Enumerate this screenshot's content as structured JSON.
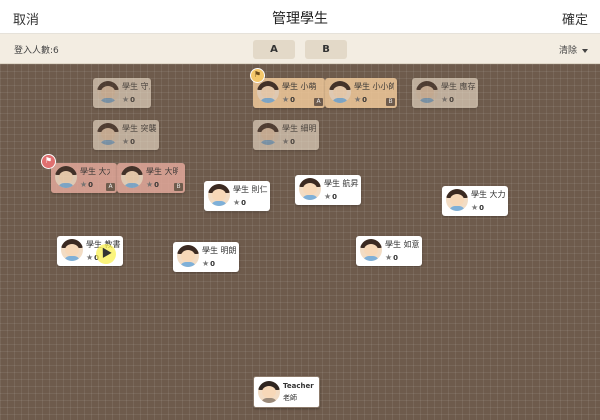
{
  "topbar": {
    "cancel": "取消",
    "title": "管理學生",
    "confirm": "確定"
  },
  "subbar": {
    "count": "登入人數:6",
    "tab_a": "A",
    "tab_b": "B",
    "clear": "清除"
  },
  "students": [
    {
      "name": "學生 守人",
      "score": "0"
    },
    {
      "name": "學生 小萌",
      "score": "0",
      "group": "A"
    },
    {
      "name": "學生 小小帥",
      "score": "0",
      "group": "B"
    },
    {
      "name": "學生 應存",
      "score": "0"
    },
    {
      "name": "學生 突襲",
      "score": "0"
    },
    {
      "name": "學生 細明",
      "score": "0"
    },
    {
      "name": "學生 大大",
      "score": "0",
      "group": "A"
    },
    {
      "name": "學生 大明",
      "score": "0",
      "group": "B"
    },
    {
      "name": "學生 則仁",
      "score": "0"
    },
    {
      "name": "學生 航昇",
      "score": "0"
    },
    {
      "name": "學生 大力",
      "score": "0"
    },
    {
      "name": "學生 教書",
      "score": "0"
    },
    {
      "name": "學生 明朗",
      "score": "0"
    },
    {
      "name": "學生 如意",
      "score": "0"
    }
  ],
  "teacher": {
    "name": "Teacher",
    "role": "老師"
  },
  "colors": {
    "board": "#6e5b4c",
    "group_a": "#f0c99a",
    "group_b": "#e2a89a",
    "flag_yellow": "#f5c76a",
    "flag_red": "#e07070"
  }
}
